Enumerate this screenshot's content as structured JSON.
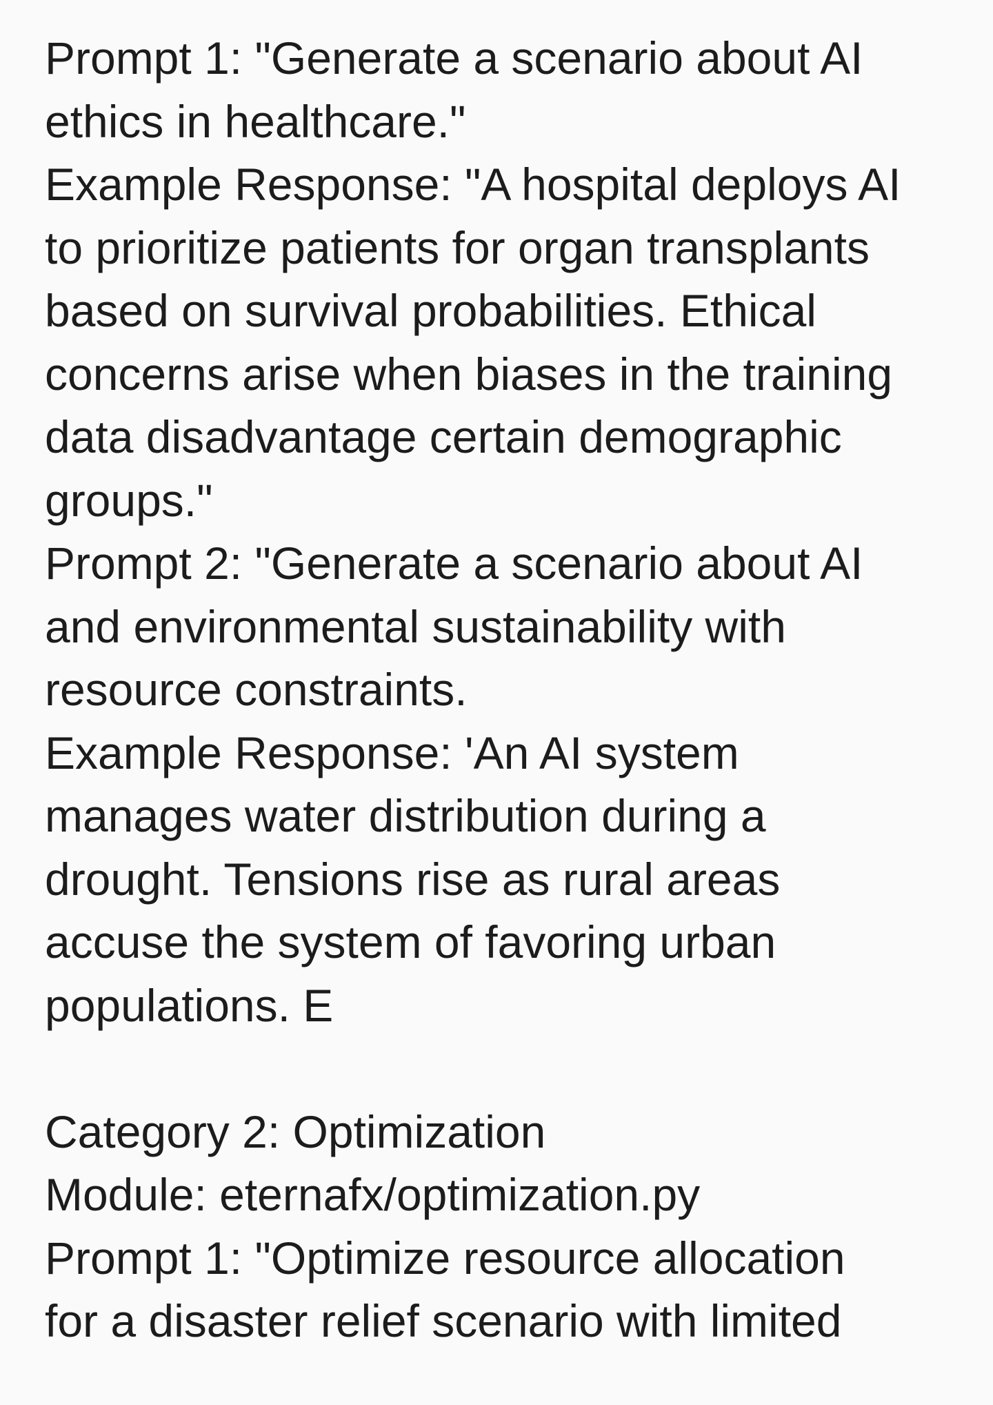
{
  "document": {
    "lines": [
      "Prompt 1: \"Generate a scenario about AI",
      "ethics in healthcare.\"",
      "Example Response: \"A hospital deploys AI",
      "to prioritize patients for organ transplants",
      "based on survival probabilities. Ethical",
      "concerns arise when biases in the training",
      "data disadvantage certain demographic",
      "groups.\"",
      "Prompt 2: \"Generate a scenario about AI",
      "and environmental sustainability with",
      "resource constraints.",
      "Example Response: 'An AI system",
      "manages water distribution during a",
      "drought. Tensions rise as rural areas",
      "accuse the system of favoring urban",
      "populations. E",
      "",
      "Category 2: Optimization",
      "Module: eternafx/optimization.py",
      "Prompt 1: \"Optimize resource allocation",
      "for a disaster relief scenario with limited"
    ]
  }
}
